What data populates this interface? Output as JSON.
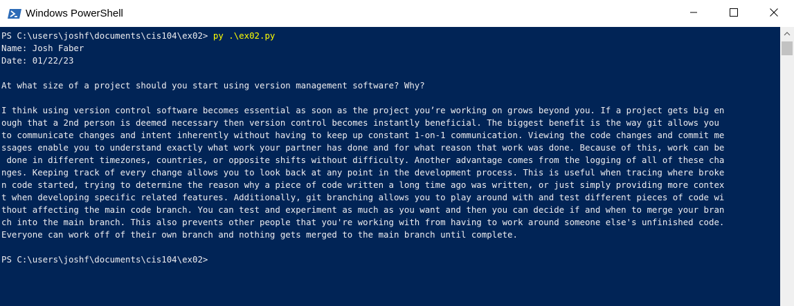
{
  "window": {
    "title": "Windows PowerShell",
    "icon": "powershell-icon",
    "controls": [
      "minimize-icon",
      "maximize-icon",
      "close-icon"
    ]
  },
  "colors": {
    "console_bg": "#012456",
    "console_text": "#eeedf0",
    "command_text": "#ffff00",
    "titlebar_bg": "#ffffff"
  },
  "console": {
    "prompt1": "PS C:\\users\\joshf\\documents\\cis104\\ex02> ",
    "command1": "py .\\ex02.py",
    "lines": [
      "Name: Josh Faber",
      "Date: 01/22/23",
      "",
      "At what size of a project should you start using version management software? Why?",
      "",
      "I think using version control software becomes essential as soon as the project you’re working on grows beyond you. If a project gets big en",
      "ough that a 2nd person is deemed necessary then version control becomes instantly beneficial. The biggest benefit is the way git allows you",
      "to communicate changes and intent inherently without having to keep up constant 1-on-1 communication. Viewing the code changes and commit me",
      "ssages enable you to understand exactly what work your partner has done and for what reason that work was done. Because of this, work can be",
      " done in different timezones, countries, or opposite shifts without difficulty. Another advantage comes from the logging of all of these cha",
      "nges. Keeping track of every change allows you to look back at any point in the development process. This is useful when tracing where broke",
      "n code started, trying to determine the reason why a piece of code written a long time ago was written, or just simply providing more contex",
      "t when developing specific related features. Additionally, git branching allows you to play around with and test different pieces of code wi",
      "thout affecting the main code branch. You can test and experiment as much as you want and then you can decide if and when to merge your bran",
      "ch into the main branch. This also prevents other people that you're working with from having to work around someone else's unfinished code.",
      "Everyone can work off of their own branch and nothing gets merged to the main branch until complete.",
      ""
    ],
    "prompt2": "PS C:\\users\\joshf\\documents\\cis104\\ex02>"
  }
}
